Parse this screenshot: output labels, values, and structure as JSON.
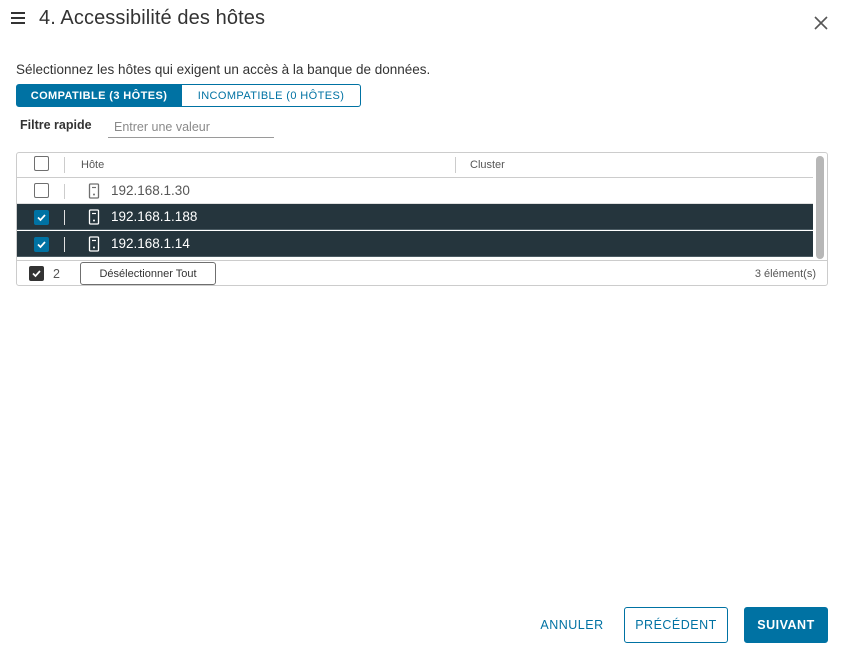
{
  "header": {
    "title": "4. Accessibilité des hôtes"
  },
  "instruction": "Sélectionnez les hôtes qui exigent un accès à la banque de données.",
  "tabs": [
    {
      "label": "COMPATIBLE (3 HÔTES)",
      "active": true
    },
    {
      "label": "INCOMPATIBLE (0 HÔTES)",
      "active": false
    }
  ],
  "filter": {
    "label": "Filtre rapide",
    "placeholder": "Entrer une valeur",
    "value": ""
  },
  "grid": {
    "columns": [
      "Hôte",
      "Cluster"
    ],
    "rows": [
      {
        "host": "192.168.1.30",
        "cluster": "",
        "selected": false
      },
      {
        "host": "192.168.1.188",
        "cluster": "",
        "selected": true
      },
      {
        "host": "192.168.1.14",
        "cluster": "",
        "selected": true
      }
    ],
    "footer": {
      "selected_count": "2",
      "deselect_label": "Désélectionner Tout",
      "total": "3 élément(s)"
    }
  },
  "buttons": {
    "cancel": "ANNULER",
    "previous": "PRÉCÉDENT",
    "next": "SUIVANT"
  },
  "colors": {
    "accent": "#0072a3",
    "selected_row": "#25353d"
  },
  "icons": {
    "menu": "hamburger-icon",
    "close": "close-icon",
    "host": "host-server-icon",
    "check": "checkmark-icon"
  }
}
